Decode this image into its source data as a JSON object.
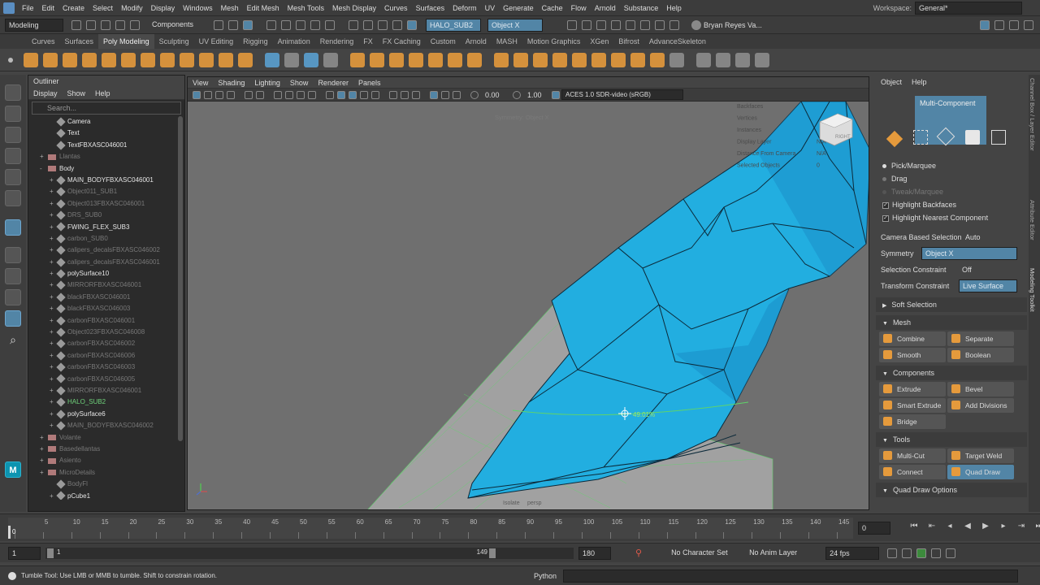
{
  "menubar": {
    "items": [
      "File",
      "Edit",
      "Create",
      "Select",
      "Modify",
      "Display",
      "Windows",
      "Mesh",
      "Edit Mesh",
      "Mesh Tools",
      "Mesh Display",
      "Curves",
      "Surfaces",
      "Deform",
      "UV",
      "Generate",
      "Cache",
      "Flow",
      "Arnold",
      "Substance",
      "Help"
    ],
    "workspace_label": "Workspace:",
    "workspace_value": "General*"
  },
  "statusline": {
    "mode": "Modeling",
    "components": "Components",
    "object_name": "HALO_SUB2",
    "symmetry_field": "Object X",
    "user": "Bryan Reyes Va..."
  },
  "shelf": {
    "tabs": [
      "Curves",
      "Surfaces",
      "Poly Modeling",
      "Sculpting",
      "UV Editing",
      "Rigging",
      "Animation",
      "Rendering",
      "FX",
      "FX Caching",
      "Custom",
      "Arnold",
      "MASH",
      "Motion Graphics",
      "XGen",
      "Bifrost",
      "AdvanceSkeleton"
    ],
    "active_tab": "Poly Modeling"
  },
  "outliner": {
    "title": "Outliner",
    "menu": [
      "Display",
      "Show",
      "Help"
    ],
    "search_placeholder": "Search...",
    "items": [
      {
        "label": "Camera",
        "style": "normal",
        "indent": 1,
        "icon": "cam"
      },
      {
        "label": "Text",
        "style": "normal",
        "indent": 1,
        "icon": "obj"
      },
      {
        "label": "TextFBXASC046001",
        "style": "normal",
        "indent": 1,
        "icon": "obj"
      },
      {
        "label": "Llantas",
        "style": "dim",
        "indent": 0,
        "icon": "grp",
        "exp": "+"
      },
      {
        "label": "Body",
        "style": "normal",
        "indent": 0,
        "icon": "grp",
        "exp": "-"
      },
      {
        "label": "MAIN_BODYFBXASC046001",
        "style": "normal",
        "indent": 1,
        "icon": "obj",
        "exp": "+"
      },
      {
        "label": "Object011_SUB1",
        "style": "dim",
        "indent": 1,
        "icon": "obj",
        "exp": "+"
      },
      {
        "label": "Object013FBXASC046001",
        "style": "dim",
        "indent": 1,
        "icon": "obj",
        "exp": "+"
      },
      {
        "label": "DRS_SUB0",
        "style": "dim",
        "indent": 1,
        "icon": "obj",
        "exp": "+"
      },
      {
        "label": "FWING_FLEX_SUB3",
        "style": "normal",
        "indent": 1,
        "icon": "obj",
        "exp": "+"
      },
      {
        "label": "carbon_SUB0",
        "style": "dim",
        "indent": 1,
        "icon": "obj",
        "exp": "+"
      },
      {
        "label": "calipers_decalsFBXASC046002",
        "style": "dim",
        "indent": 1,
        "icon": "obj",
        "exp": "+"
      },
      {
        "label": "calipers_decalsFBXASC046001",
        "style": "dim",
        "indent": 1,
        "icon": "obj",
        "exp": "+"
      },
      {
        "label": "polySurface10",
        "style": "normal",
        "indent": 1,
        "icon": "obj",
        "exp": "+"
      },
      {
        "label": "MIRRORFBXASC046001",
        "style": "dim",
        "indent": 1,
        "icon": "obj",
        "exp": "+"
      },
      {
        "label": "blackFBXASC046001",
        "style": "dim",
        "indent": 1,
        "icon": "obj",
        "exp": "+"
      },
      {
        "label": "blackFBXASC046003",
        "style": "dim",
        "indent": 1,
        "icon": "obj",
        "exp": "+"
      },
      {
        "label": "carbonFBXASC046001",
        "style": "dim",
        "indent": 1,
        "icon": "obj",
        "exp": "+"
      },
      {
        "label": "Object023FBXASC046008",
        "style": "dim",
        "indent": 1,
        "icon": "obj",
        "exp": "+"
      },
      {
        "label": "carbonFBXASC046002",
        "style": "dim",
        "indent": 1,
        "icon": "obj",
        "exp": "+"
      },
      {
        "label": "carbonFBXASC046006",
        "style": "dim",
        "indent": 1,
        "icon": "obj",
        "exp": "+"
      },
      {
        "label": "carbonFBXASC046003",
        "style": "dim",
        "indent": 1,
        "icon": "obj",
        "exp": "+"
      },
      {
        "label": "carbonFBXASC046005",
        "style": "dim",
        "indent": 1,
        "icon": "obj",
        "exp": "+"
      },
      {
        "label": "MIRRORFBXASC046001",
        "style": "dim",
        "indent": 1,
        "icon": "obj",
        "exp": "+"
      },
      {
        "label": "HALO_SUB2",
        "style": "green",
        "indent": 1,
        "icon": "obj",
        "exp": "+"
      },
      {
        "label": "polySurface6",
        "style": "normal",
        "indent": 1,
        "icon": "obj",
        "exp": "+"
      },
      {
        "label": "MAIN_BODYFBXASC046002",
        "style": "dim",
        "indent": 1,
        "icon": "obj",
        "exp": "+"
      },
      {
        "label": "Volante",
        "style": "dim",
        "indent": 0,
        "icon": "grp",
        "exp": "+"
      },
      {
        "label": "Basedellantas",
        "style": "dim",
        "indent": 0,
        "icon": "grp",
        "exp": "+"
      },
      {
        "label": "Asiento",
        "style": "dim",
        "indent": 0,
        "icon": "grp",
        "exp": "+"
      },
      {
        "label": "MicroDetails",
        "style": "dim",
        "indent": 0,
        "icon": "grp",
        "exp": "+"
      },
      {
        "label": "BodyFl",
        "style": "dim",
        "indent": 1,
        "icon": "obj"
      },
      {
        "label": "pCube1",
        "style": "normal",
        "indent": 1,
        "icon": "obj",
        "exp": "+"
      }
    ]
  },
  "viewport": {
    "menu": [
      "View",
      "Shading",
      "Lighting",
      "Show",
      "Renderer",
      "Panels"
    ],
    "exposure": "0.00",
    "gamma": "1.00",
    "color_space": "ACES 1.0 SDR-video (sRGB)",
    "symmetry_label": "Symmetry: Object X",
    "hud_labels": [
      "Backfaces",
      "Vertices",
      "Instances",
      "Display Layer",
      "Distance From Camera",
      "Selected Objects"
    ],
    "hud_values": [
      "",
      "",
      "",
      "N/A",
      "N/A",
      "0"
    ],
    "cube_label": "RIGHT",
    "cursor_pct": "49.01%",
    "footer_left": "Isolate",
    "footer_right": "persp"
  },
  "rightpanel": {
    "menu": [
      "Object",
      "Help"
    ],
    "header": "Multi-Component",
    "pick_marquee": "Pick/Marquee",
    "drag": "Drag",
    "tweak_marquee": "Tweak/Marquee",
    "highlight_backfaces": "Highlight Backfaces",
    "highlight_nearest": "Highlight Nearest Component",
    "camera_sel_label": "Camera Based Selection",
    "camera_sel_value": "Auto",
    "symmetry_label": "Symmetry",
    "symmetry_value": "Object X",
    "sel_constraint_label": "Selection Constraint",
    "sel_constraint_value": "Off",
    "transform_constraint_label": "Transform Constraint",
    "transform_constraint_value": "Live Surface",
    "soft_selection": "Soft Selection",
    "mesh_section": "Mesh",
    "mesh_buttons": [
      "Combine",
      "Separate",
      "Smooth",
      "Boolean"
    ],
    "components_section": "Components",
    "component_buttons": [
      "Extrude",
      "Bevel",
      "Smart Extrude",
      "Add Divisions",
      "Bridge"
    ],
    "tools_section": "Tools",
    "tool_buttons": [
      "Multi-Cut",
      "Target Weld",
      "Connect",
      "Quad Draw"
    ],
    "quad_draw_options": "Quad Draw Options"
  },
  "sidetabs": [
    "Channel Box / Layer Editor",
    "Attribute Editor",
    "Modeling Toolkit"
  ],
  "timeline": {
    "ticks": [
      "0",
      "5",
      "10",
      "15",
      "20",
      "25",
      "30",
      "35",
      "40",
      "45",
      "50",
      "55",
      "60",
      "65",
      "70",
      "75",
      "80",
      "85",
      "90",
      "95",
      "100",
      "105",
      "110",
      "115",
      "120",
      "125",
      "130",
      "135",
      "140",
      "145"
    ],
    "current_frame": "0"
  },
  "range": {
    "start": "1",
    "inner_start": "1",
    "inner_end": "149",
    "end": "180",
    "character_set": "No Character Set",
    "anim_layer": "No Anim Layer",
    "fps": "24 fps"
  },
  "helpline": {
    "text": "Tumble Tool: Use LMB or MMB to tumble. Shift to constrain rotation.",
    "script_type": "Python"
  },
  "colors": {
    "mesh_blue": "#22aee0",
    "accent_blue": "#5285a6",
    "wire_green": "#5fd46a",
    "icon_orange": "#e59a3c"
  }
}
